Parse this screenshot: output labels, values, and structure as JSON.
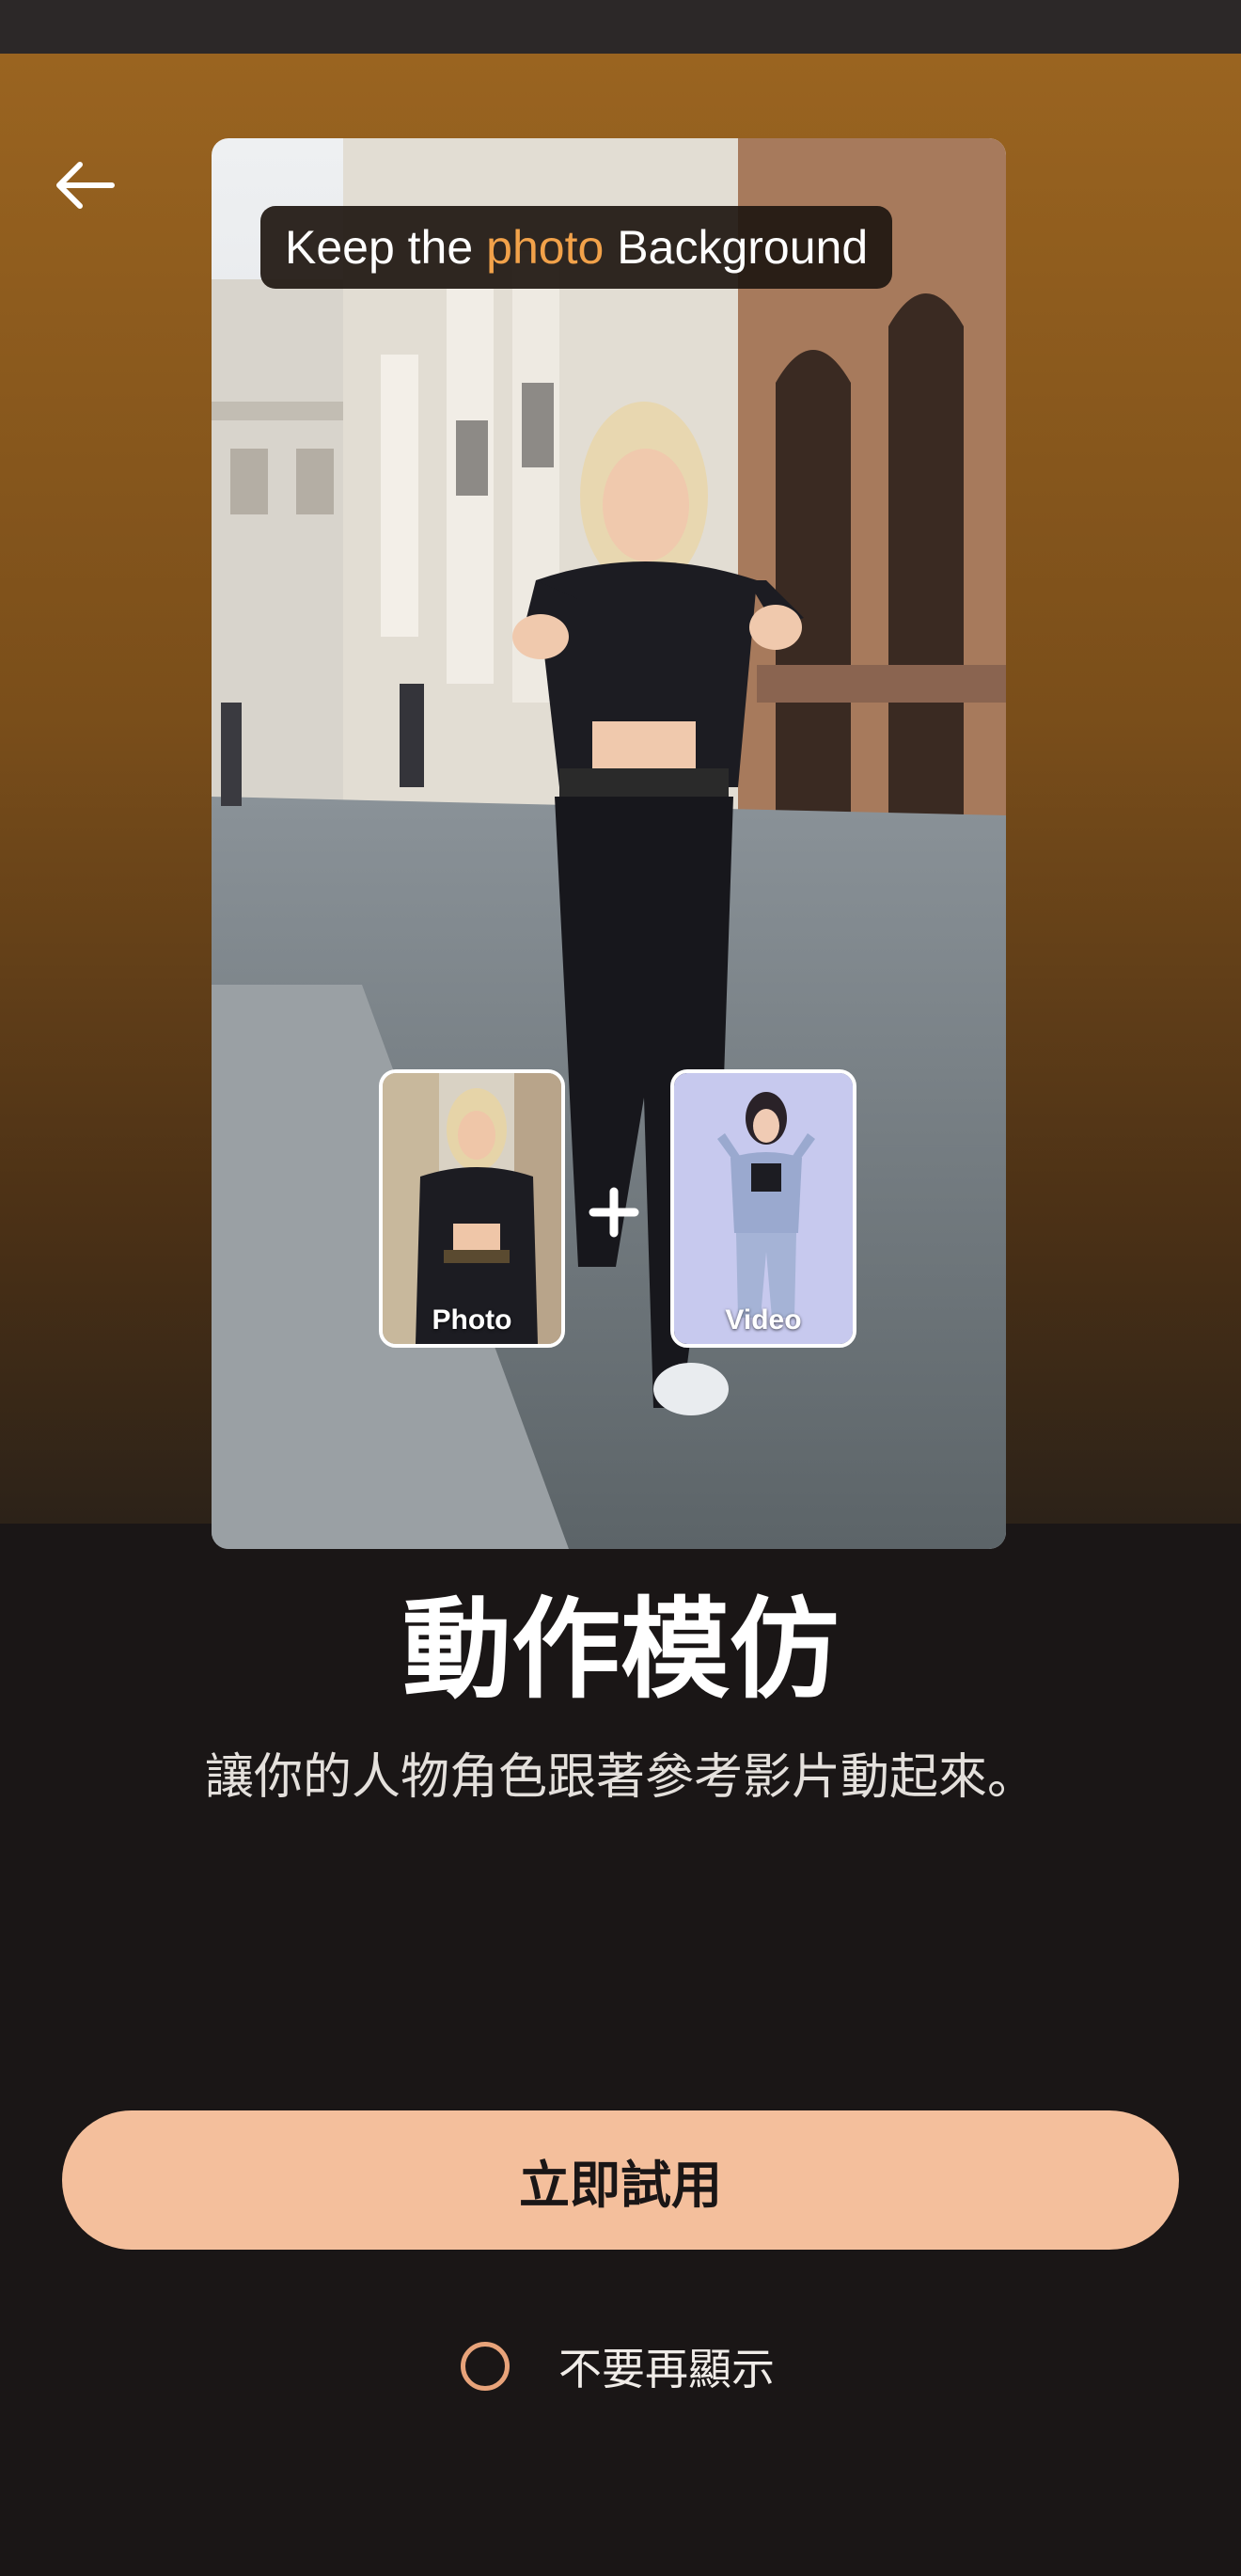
{
  "status_bar": {},
  "hero": {
    "back_icon": "arrow-left-icon",
    "preview": {
      "caption_prefix": "Keep the",
      "caption_highlight": "photo",
      "caption_suffix": "Background",
      "highlight_color": "#f2a24a",
      "thumbs": [
        {
          "label": "Photo"
        },
        {
          "label": "Video"
        }
      ],
      "plus_icon": "plus-icon"
    }
  },
  "content": {
    "title": "動作模仿",
    "subtitle": "讓你的人物角色跟著參考影片動起來。"
  },
  "actions": {
    "primary_label": "立即試用",
    "primary_color": "#f4bf9c",
    "dont_show_label": "不要再顯示",
    "dont_show_checked": false,
    "radio_color": "#e8a37a"
  }
}
